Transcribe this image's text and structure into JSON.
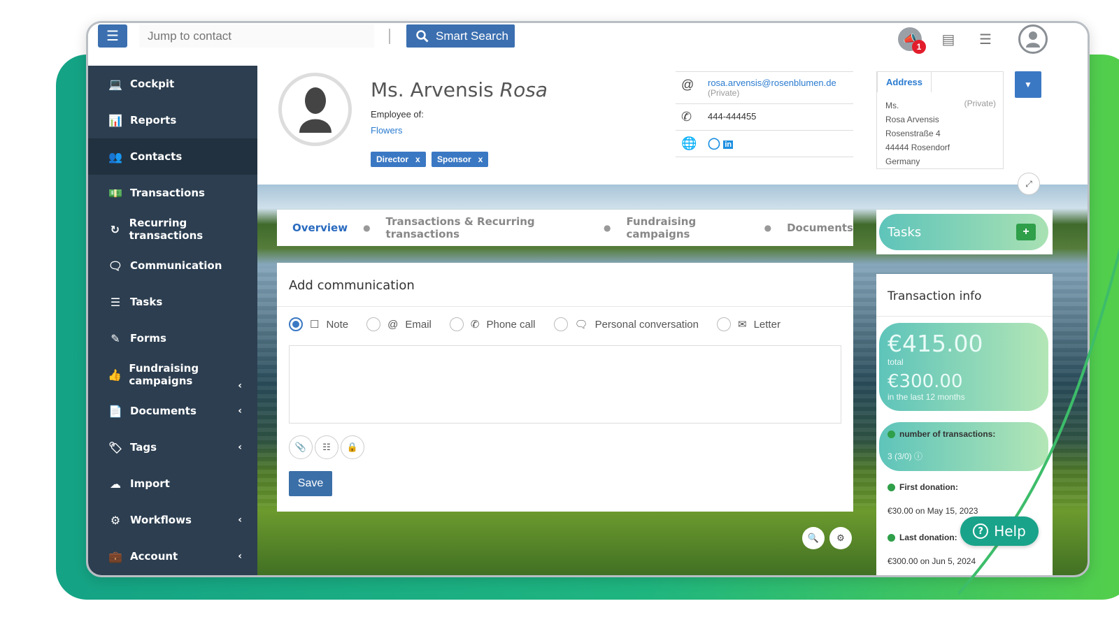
{
  "colors": {
    "accent": "#3b6fb0",
    "sidebar_bg": "#2c3e50",
    "brand_green": "#19a38a",
    "notification": "#e21d2c"
  },
  "topbar": {
    "jump_placeholder": "Jump to contact",
    "smart_search_label": "Smart Search",
    "notification_count": "1",
    "icons": [
      "menu-icon",
      "search-icon",
      "megaphone-icon",
      "newspaper-icon",
      "tasks-list-icon",
      "user-icon"
    ]
  },
  "sidebar": {
    "items": [
      {
        "label": "Cockpit",
        "icon": "laptop-icon",
        "submenu": false
      },
      {
        "label": "Reports",
        "icon": "chart-icon",
        "submenu": false
      },
      {
        "label": "Contacts",
        "icon": "users-icon",
        "submenu": false
      },
      {
        "label": "Transactions",
        "icon": "money-icon",
        "submenu": false
      },
      {
        "label": "Recurring transactions",
        "icon": "recurring-icon",
        "submenu": false
      },
      {
        "label": "Communication",
        "icon": "comments-icon",
        "submenu": false
      },
      {
        "label": "Tasks",
        "icon": "tasks-icon",
        "submenu": false
      },
      {
        "label": "Forms",
        "icon": "edit-icon",
        "submenu": false
      },
      {
        "label": "Fundraising campaigns",
        "icon": "thumbs-up-icon",
        "submenu": true
      },
      {
        "label": "Documents",
        "icon": "document-icon",
        "submenu": true
      },
      {
        "label": "Tags",
        "icon": "tags-icon",
        "submenu": true
      },
      {
        "label": "Import",
        "icon": "cloud-upload-icon",
        "submenu": false
      },
      {
        "label": "Workflows",
        "icon": "robot-icon",
        "submenu": true
      },
      {
        "label": "Account",
        "icon": "briefcase-icon",
        "submenu": true
      }
    ]
  },
  "contact": {
    "salutation": "Ms. Arvensis",
    "first_name": "Rosa",
    "employee_of_label": "Employee of:",
    "company": "Flowers",
    "tags": [
      "Director",
      "Sponsor"
    ],
    "email": "rosa.arvensis@rosenblumen.de",
    "email_type": "(Private)",
    "phone": "444-444455",
    "social_icons": [
      "instagram-icon",
      "linkedin-icon"
    ]
  },
  "address": {
    "tab_label": "Address",
    "type": "(Private)",
    "lines": [
      "Ms.",
      "Rosa Arvensis",
      "Rosenstraße 4",
      "44444 Rosendorf",
      "Germany"
    ]
  },
  "tabs": [
    "Overview",
    "Transactions & Recurring transactions",
    "Fundraising campaigns",
    "Documents"
  ],
  "communication": {
    "title": "Add communication",
    "types": [
      {
        "label": "Note",
        "icon": "note-icon",
        "selected": true
      },
      {
        "label": "Email",
        "icon": "at-icon",
        "selected": false
      },
      {
        "label": "Phone call",
        "icon": "phone-icon",
        "selected": false
      },
      {
        "label": "Personal conversation",
        "icon": "comments-icon",
        "selected": false
      },
      {
        "label": "Letter",
        "icon": "envelope-icon",
        "selected": false
      }
    ],
    "save_label": "Save"
  },
  "tasks": {
    "title": "Tasks"
  },
  "transaction_info": {
    "title": "Transaction info",
    "total": "€415.00",
    "total_label": "total",
    "last12": "€300.00",
    "last12_label": "in the last 12 months",
    "count_label": "number of transactions:",
    "count_value": "3 (3/0)",
    "first_label": "First donation:",
    "first_value": "€30.00 on May 15, 2023",
    "last_label": "Last donation:",
    "last_value": "€300.00 on Jun 5, 2024"
  },
  "help": {
    "label": "Help"
  }
}
